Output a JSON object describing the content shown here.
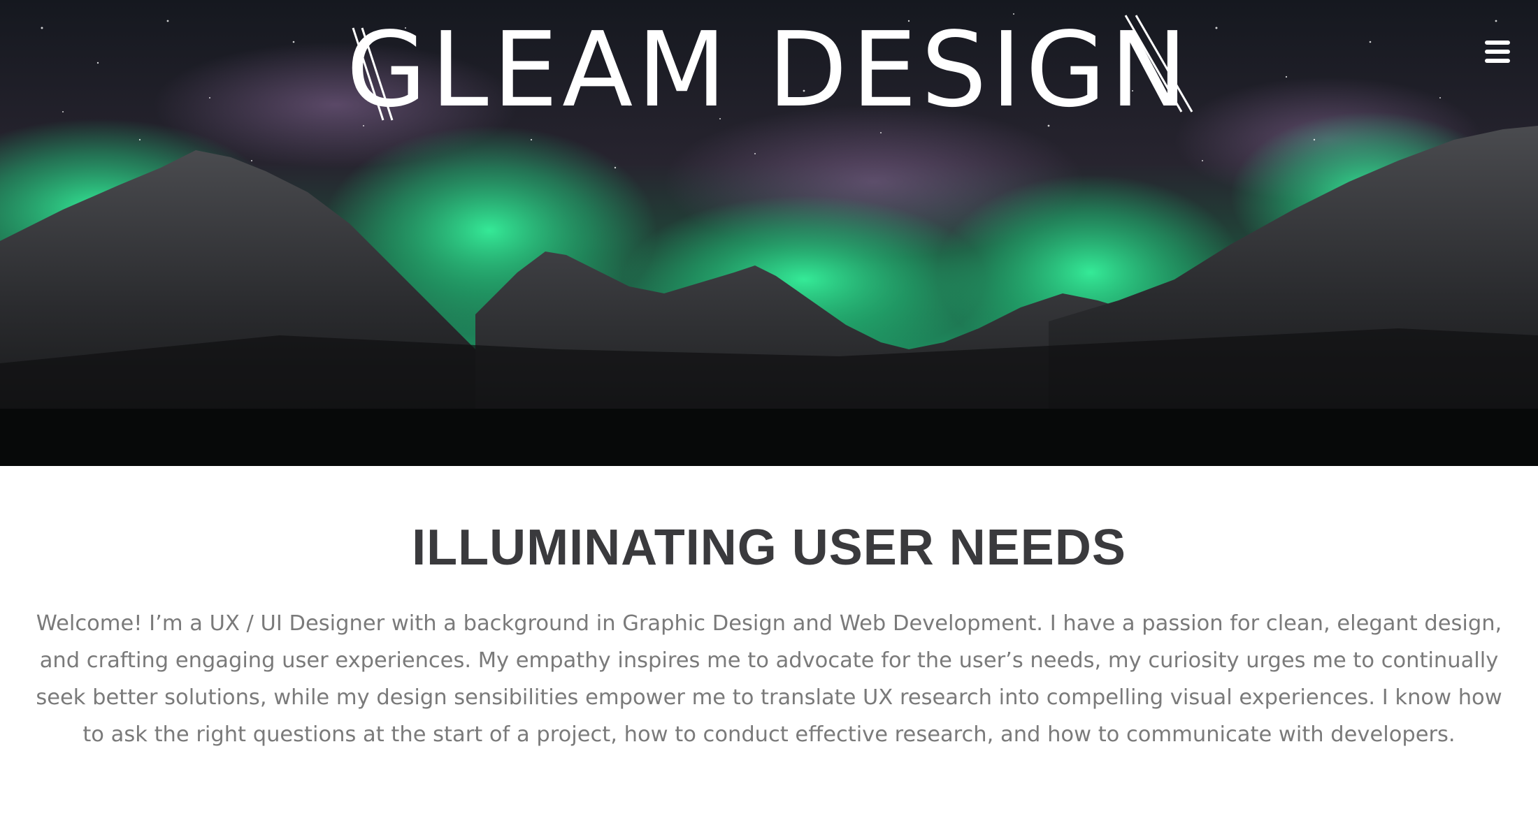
{
  "hero": {
    "logo_text": "GLEAM DESIGN",
    "menu_icon": "hamburger-menu-icon",
    "colors": {
      "sky_top": "#1a1d26",
      "sky_mid": "#2a2633",
      "aurora_green": "#2fe08f",
      "aurora_purple": "#7a5a8a",
      "mountain": "#2a2b2e",
      "ground": "#070909"
    }
  },
  "main": {
    "headline": "ILLUMINATING USER NEEDS",
    "intro": "Welcome! I’m a UX / UI Designer with a background in Graphic Design and Web Development. I have a passion for clean, elegant design, and crafting engaging user experiences. My empathy inspires me to advocate for the user’s needs, my curiosity urges me to continually seek better solutions, while my design sensibilities empower me to translate UX research into compelling visual experiences. I know how to ask the right questions at the start of a project, how to conduct effective research, and how to communicate with developers."
  },
  "colors": {
    "headline": "#3a3a3d",
    "body_text": "#7a7a7a",
    "background": "#ffffff"
  }
}
